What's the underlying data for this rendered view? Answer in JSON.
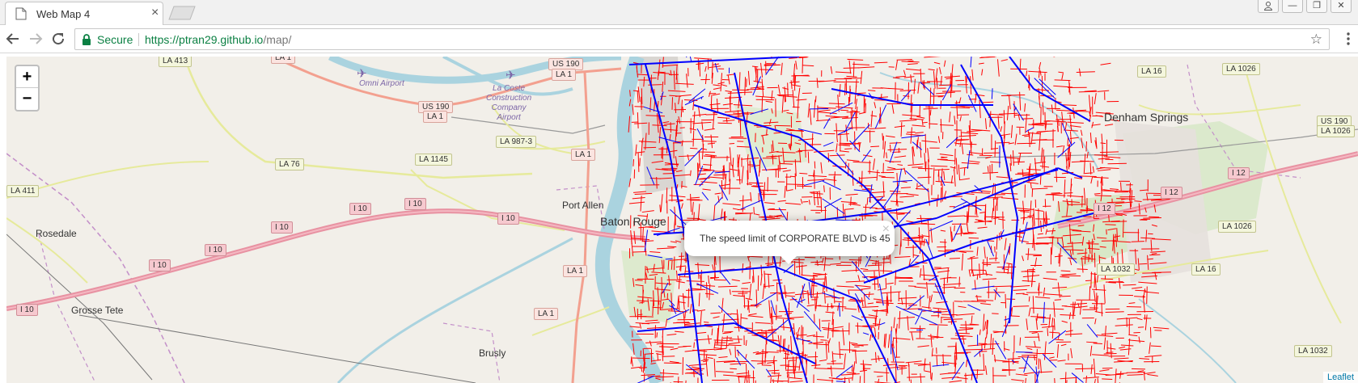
{
  "browser": {
    "tab_title": "Web Map 4",
    "tab_close": "×",
    "secure_label": "Secure",
    "url_scheme": "https://",
    "url_host": "ptran29.github.io",
    "url_path": "/map/",
    "window_buttons": [
      "",
      "—",
      "❐",
      "✕"
    ]
  },
  "map": {
    "zoom_in": "+",
    "zoom_out": "−",
    "popup_text": "The speed limit of CORPORATE BLVD is 45",
    "popup_close": "×",
    "attribution": "Leaflet",
    "places": {
      "port_allen": "Port Allen",
      "baton_rouge": "Baton Rouge",
      "rosedale": "Rosedale",
      "grosse_tete": "Grosse Tete",
      "brusly": "Brusly",
      "denham_springs": "Denham Springs"
    },
    "pois": {
      "omni_airport": "Omni Airport",
      "lacoste_airport": "La Coste\nConstruction\nCompany\nAirport"
    },
    "shields": {
      "la413": "LA 413",
      "la1_top": "LA 1",
      "us190_a": "US 190",
      "la1_a": "LA 1",
      "us190_b": "US 190",
      "la1_b": "LA 1",
      "la9873": "LA 987-3",
      "la76": "LA 76",
      "la1145": "LA 1145",
      "la1_c": "LA 1",
      "la411": "LA 411",
      "i10_a": "I 10",
      "i10_b": "I 10",
      "i10_c": "I 10",
      "i10_d": "I 10",
      "i10_e": "I 10",
      "i10_f": "I 10",
      "i10_g": "I 10",
      "la1_d": "LA 1",
      "la1_e": "LA 1",
      "la16_a": "LA 16",
      "la1026_a": "LA 1026",
      "us190_c": "US 190",
      "la1026_b": "LA 1026",
      "i12_a": "I 12",
      "i12_b": "I 12",
      "i12_c": "I 12",
      "la1026_c": "LA 1026",
      "la1032": "LA 1032",
      "la16_b": "LA 16",
      "la1032_b": "LA 1032"
    },
    "colors": {
      "land": "#f2efe9",
      "water": "#aad3df",
      "river": "#9fc9e0",
      "interstate": "#e892a2",
      "primary": "#fcd6a4",
      "secondary": "#f7fabf",
      "overlay_red": "#ff0000",
      "overlay_blue": "#0000ff"
    }
  }
}
